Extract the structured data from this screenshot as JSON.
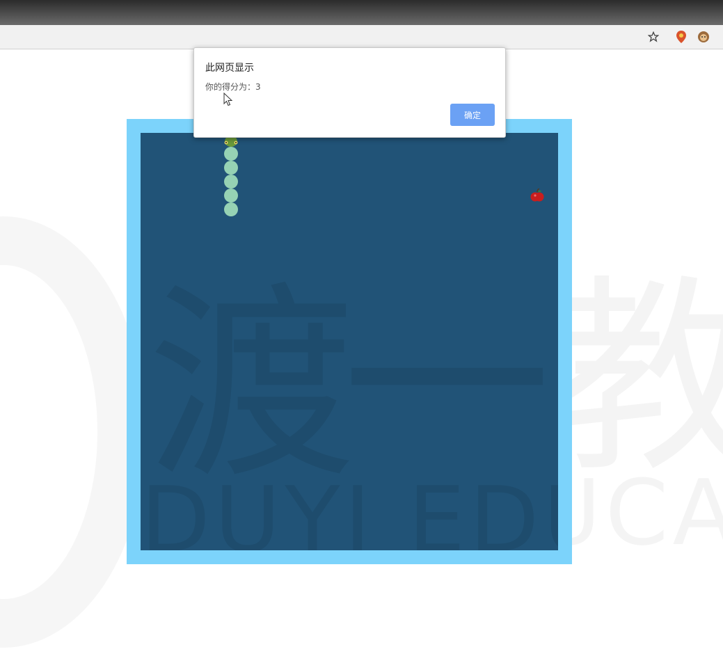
{
  "browser": {
    "icons": [
      "star-icon",
      "location-pin-icon",
      "monkey-extension-icon"
    ]
  },
  "watermark": {
    "big_char_left": "渡",
    "big_char_mid": "一",
    "big_char_right": "教",
    "text": "DUYI EDUCAT"
  },
  "game": {
    "snake_color": "#96d2b4",
    "board_color": "#215377",
    "border_color": "#7cd3fb",
    "snake_body_cells": [
      [
        6,
        1
      ],
      [
        6,
        2
      ],
      [
        6,
        3
      ],
      [
        6,
        4
      ],
      [
        6,
        5
      ]
    ],
    "snake_head_cell": [
      6,
      0
    ],
    "food_cell": [
      28,
      4
    ],
    "food_icon": "apple-icon"
  },
  "dialog": {
    "title": "此网页显示",
    "message": "你的得分为：3",
    "ok_label": "确定",
    "ok_color": "#6ba1f4"
  }
}
